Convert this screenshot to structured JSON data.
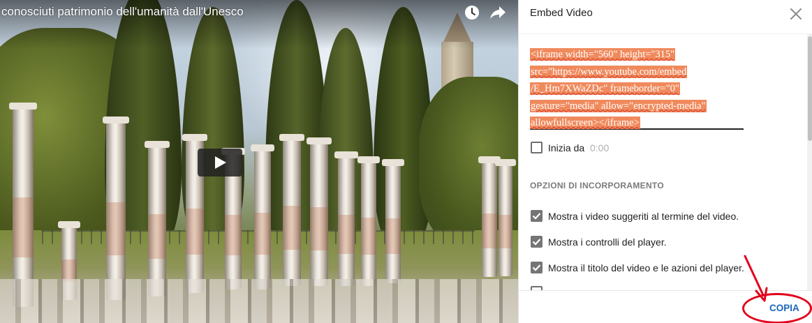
{
  "player": {
    "title": "conosciuti patrimonio dell'umanità dall'Unesco",
    "icons": {
      "watch_later": "clock-icon",
      "share": "share-arrow-icon",
      "play": "play-icon"
    }
  },
  "panel": {
    "title": "Embed Video",
    "close_icon": "close-icon",
    "embed_code_lines": [
      "<iframe width=\"560\" height=\"315\"",
      "src=\"https://www.youtube.com/embed",
      "/E_Hm7XWaZDc\" frameborder=\"0\"",
      "gesture=\"media\" allow=\"encrypted-media\"",
      "allowfullscreen></iframe>"
    ],
    "start_at": {
      "label": "Inizia da",
      "value": "0:00",
      "checked": false
    },
    "section_heading": "OPZIONI DI INCORPORAMENTO",
    "options": [
      {
        "label": "Mostra i video suggeriti al termine del video.",
        "checked": true
      },
      {
        "label": "Mostra i controlli del player.",
        "checked": true
      },
      {
        "label": "Mostra il titolo del video e le azioni del player.",
        "checked": true
      }
    ],
    "copy_label": "COPIA"
  },
  "colors": {
    "selection": "#f08a5d",
    "accent": "#1a66b8",
    "annotation": "#e3001b"
  }
}
